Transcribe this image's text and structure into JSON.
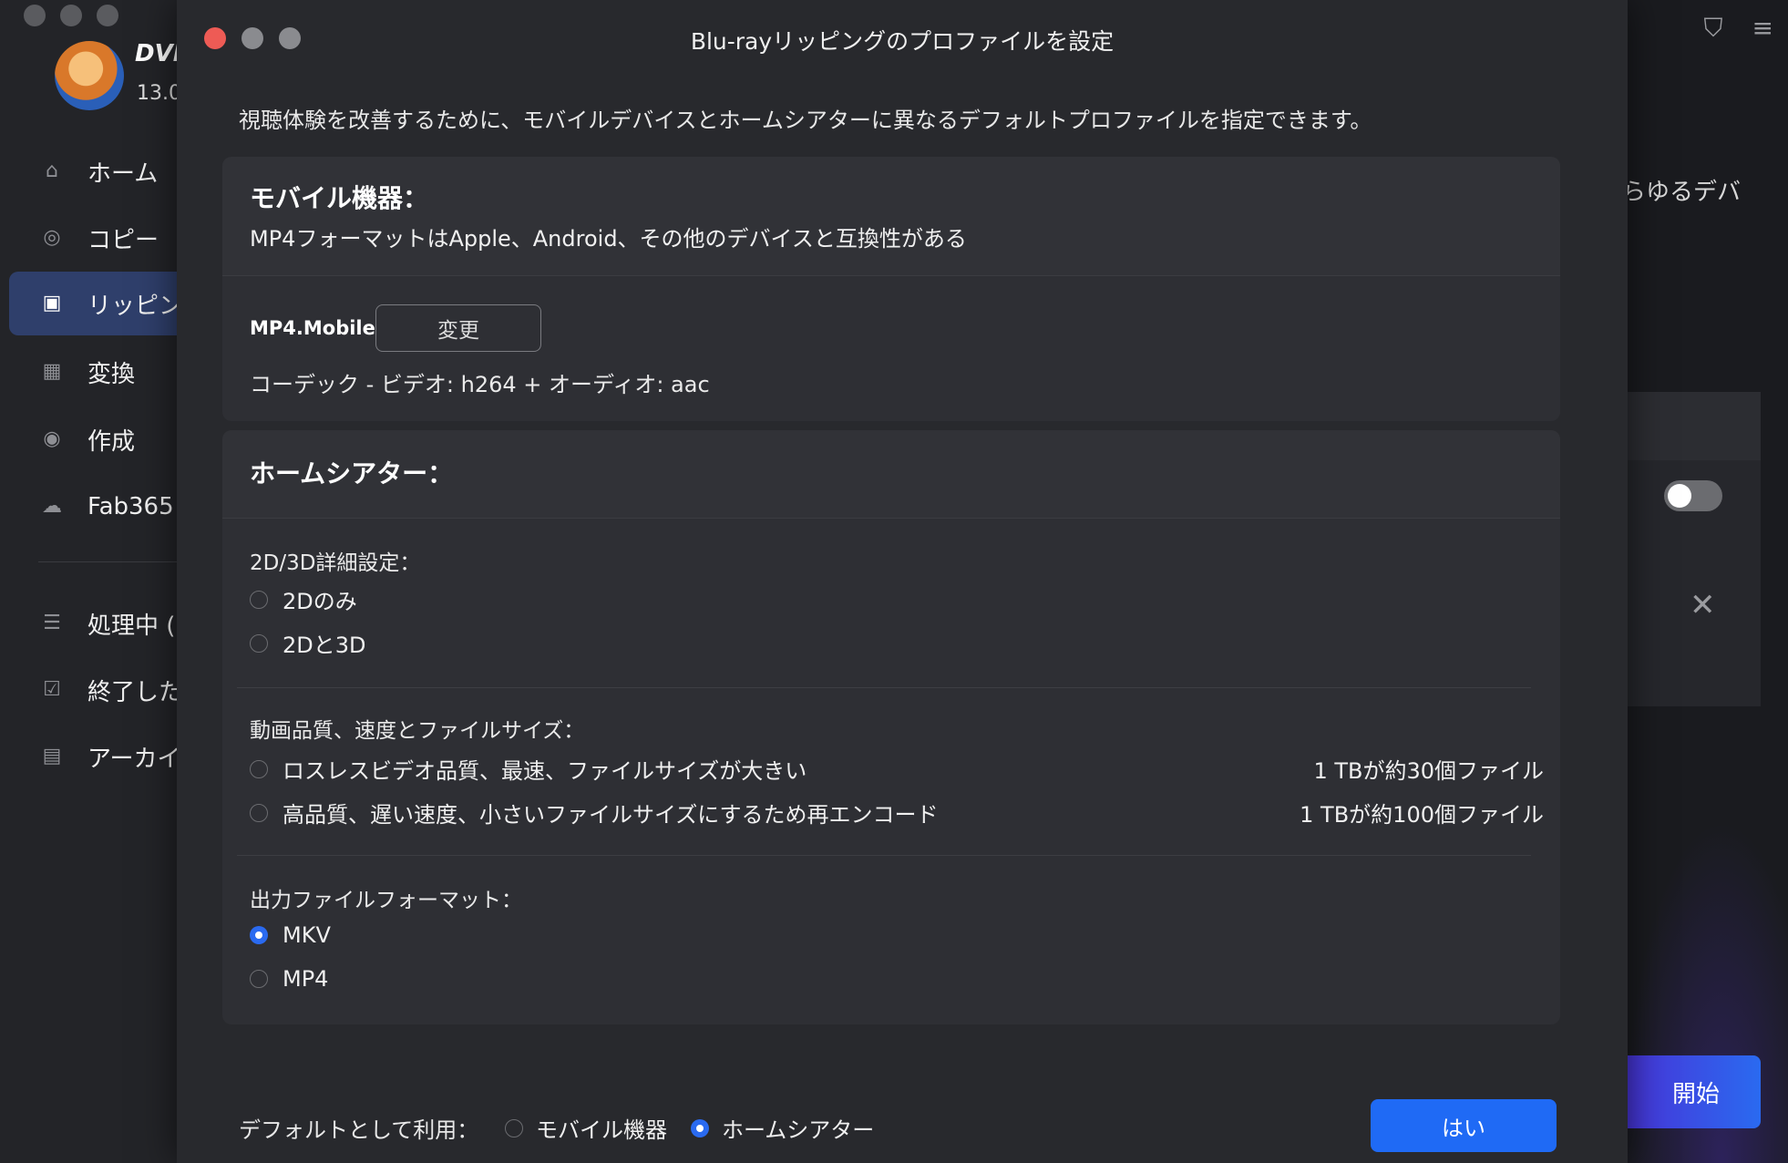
{
  "app": {
    "name": "DVD",
    "version": "13.0"
  },
  "sidebar": {
    "items": [
      {
        "label": "ホーム",
        "icon": "home-icon"
      },
      {
        "label": "コピー",
        "icon": "copy-icon"
      },
      {
        "label": "リッピン",
        "icon": "rip-icon",
        "active": true
      },
      {
        "label": "変換",
        "icon": "convert-icon"
      },
      {
        "label": "作成",
        "icon": "create-icon"
      },
      {
        "label": "Fab365",
        "icon": "fab365-icon"
      },
      {
        "label": "処理中 (",
        "icon": "processing-icon"
      },
      {
        "label": "終了した",
        "icon": "finished-icon"
      },
      {
        "label": "アーカイ",
        "icon": "archive-icon"
      }
    ]
  },
  "background": {
    "right_text": "らゆるデバ",
    "start_label": "開始"
  },
  "dialog": {
    "title": "Blu-rayリッピングのプロファイルを設定",
    "description": "視聴体験を改善するために、モバイルデバイスとホームシアターに異なるデフォルトプロファイルを指定できます。",
    "mobile": {
      "title": "モバイル機器：",
      "subtitle": "MP4フォーマットはApple、Android、その他のデバイスと互換性がある",
      "profile_name": "MP4.Mobile",
      "change_label": "変更",
      "codec": "コーデック - ビデオ: h264 + オーディオ: aac"
    },
    "home": {
      "title": "ホームシアター：",
      "dimension_label": "2D/3D詳細設定：",
      "dimension_options": [
        {
          "label": "2Dのみ",
          "selected": false
        },
        {
          "label": "2Dと3D",
          "selected": false
        }
      ],
      "quality_label": "動画品質、速度とファイルサイズ：",
      "quality_options": [
        {
          "label": "ロスレスビデオ品質、最速、ファイルサイズが大きい",
          "note": "1 TBが約30個ファイル",
          "selected": false
        },
        {
          "label": "高品質、遅い速度、小さいファイルサイズにするため再エンコード",
          "note": "1 TBが約100個ファイル",
          "selected": false
        }
      ],
      "format_label": "出力ファイルフォーマット：",
      "format_options": [
        {
          "label": "MKV",
          "selected": true
        },
        {
          "label": "MP4",
          "selected": false
        }
      ]
    },
    "footer": {
      "default_label": "デフォルトとして利用：",
      "options": [
        {
          "label": "モバイル機器",
          "selected": false
        },
        {
          "label": "ホームシアター",
          "selected": true
        }
      ],
      "ok_label": "はい"
    }
  },
  "colors": {
    "accent": "#1f6af5",
    "dialog_bg": "#28292d",
    "card_bg": "#2e2f34"
  }
}
